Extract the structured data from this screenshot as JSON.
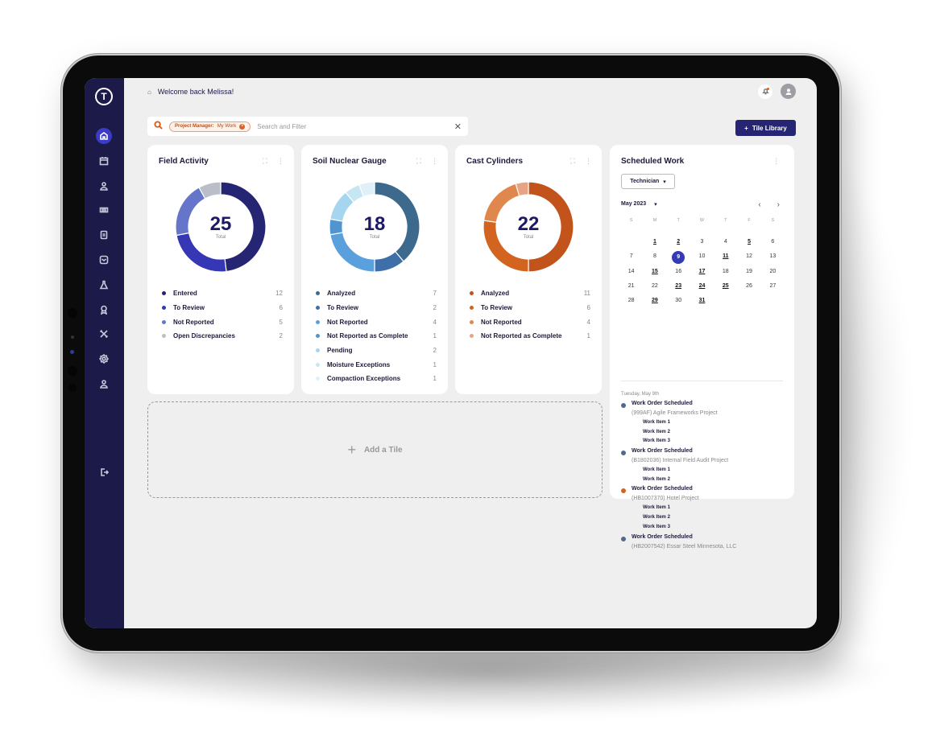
{
  "header": {
    "welcome": "Welcome back Melissa!",
    "home_icon": "home-icon",
    "notification_icon": "bell-icon",
    "avatar_icon": "user-icon"
  },
  "search": {
    "chip_key": "Project Manager:",
    "chip_value": "My Work",
    "placeholder": "Search and Filter"
  },
  "toolbar": {
    "tile_library_label": "Tile Library"
  },
  "sidebar": {
    "items": [
      {
        "name": "home",
        "active": true
      },
      {
        "name": "calendar"
      },
      {
        "name": "user"
      },
      {
        "name": "list"
      },
      {
        "name": "document"
      },
      {
        "name": "inbox"
      },
      {
        "name": "lab-flask"
      },
      {
        "name": "award"
      },
      {
        "name": "tools"
      },
      {
        "name": "settings"
      },
      {
        "name": "profile"
      }
    ],
    "logout_icon": "logout-icon"
  },
  "tiles": [
    {
      "title": "Field Activity",
      "total": "25",
      "total_label": "Total",
      "legend": [
        {
          "label": "Entered",
          "value": 12,
          "color": "#262573"
        },
        {
          "label": "To Review",
          "value": 6,
          "color": "#3537b5"
        },
        {
          "label": "Not Reported",
          "value": 5,
          "color": "#6575c9"
        },
        {
          "label": "Open Discrepancies",
          "value": 2,
          "color": "#b9bec8"
        }
      ]
    },
    {
      "title": "Soil Nuclear Gauge",
      "total": "18",
      "total_label": "Total",
      "legend": [
        {
          "label": "Analyzed",
          "value": 7,
          "color": "#3d6a8c"
        },
        {
          "label": "To Review",
          "value": 2,
          "color": "#3f6fa8"
        },
        {
          "label": "Not Reported",
          "value": 4,
          "color": "#5aa0dc"
        },
        {
          "label": "Not Reported as Complete",
          "value": 1,
          "color": "#4f95cf"
        },
        {
          "label": "Pending",
          "value": 2,
          "color": "#a6d6ef"
        },
        {
          "label": "Moisture Exceptions",
          "value": 1,
          "color": "#c7e6f4"
        },
        {
          "label": "Compaction Exceptions",
          "value": 1,
          "color": "#dff0f8"
        }
      ]
    },
    {
      "title": "Cast Cylinders",
      "total": "22",
      "total_label": "Total",
      "legend": [
        {
          "label": "Analyzed",
          "value": 11,
          "color": "#c2531a"
        },
        {
          "label": "To Review",
          "value": 6,
          "color": "#d2641f"
        },
        {
          "label": "Not Reported",
          "value": 4,
          "color": "#e0874e"
        },
        {
          "label": "Not Reported as Complete",
          "value": 1,
          "color": "#e8a482"
        }
      ]
    }
  ],
  "scheduled": {
    "title": "Scheduled Work",
    "role_select": "Technician",
    "month": "May 2023",
    "weekdays": [
      "S",
      "M",
      "T",
      "W",
      "T",
      "F",
      "S"
    ],
    "start_offset": 1,
    "days_in_month": 31,
    "selected_day": 9,
    "bold_days": [
      1,
      2,
      5,
      11,
      15,
      17,
      23,
      24,
      25,
      29,
      31
    ],
    "agenda_date": "Tuesday, May 9th",
    "events": [
      {
        "title": "Work Order Scheduled",
        "project": "(999AF) Agile Frameworks Project",
        "items": [
          "Work Item 1",
          "Work Item 2",
          "Work Item 3"
        ],
        "color": "#4f6a8a"
      },
      {
        "title": "Work Order Scheduled",
        "project": "(B1802036) Internal Field Audit Project",
        "items": [
          "Work Item 1",
          "Work Item 2"
        ],
        "color": "#4f6a8a"
      },
      {
        "title": "Work Order Scheduled",
        "project": "(HB1007370) Hotel Project",
        "items": [
          "Work Item 1",
          "Work Item 2",
          "Work Item 3"
        ],
        "color": "#d2641f"
      },
      {
        "title": "Work Order Scheduled",
        "project": "(HB2007542) Essar Steel Minnesota, LLC",
        "items": [],
        "color": "#4f6a8a"
      }
    ]
  },
  "add_tile": {
    "label": "Add a Tile"
  }
}
